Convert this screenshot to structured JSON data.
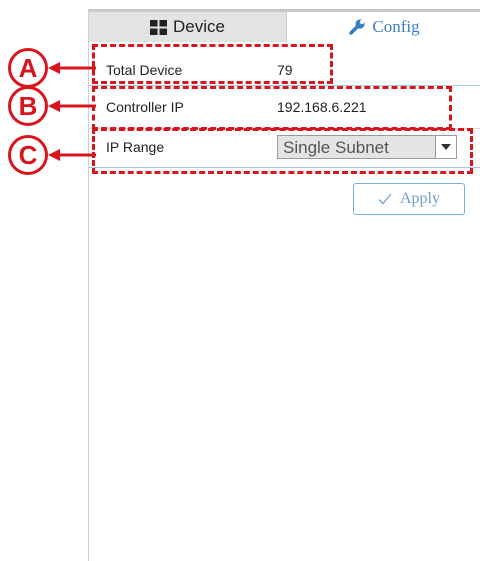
{
  "tabs": {
    "device_label": "Device",
    "config_label": "Config",
    "active": "Config"
  },
  "settings": {
    "total_device_label": "Total Device",
    "total_device_value": "79",
    "controller_ip_label": "Controller IP",
    "controller_ip_value": "192.168.6.221",
    "ip_range_label": "IP Range",
    "ip_range_selected": "Single Subnet"
  },
  "actions": {
    "apply_label": "Apply",
    "apply_icon": "checkmark-icon"
  },
  "annotations": [
    {
      "letter": "A",
      "target": "Total Device row"
    },
    {
      "letter": "B",
      "target": "Controller IP row"
    },
    {
      "letter": "C",
      "target": "IP Range row"
    }
  ],
  "colors": {
    "annotation_red": "#d8141c",
    "accent_blue": "#3a7fc6",
    "inactive_tab": "#e3e3e3"
  }
}
